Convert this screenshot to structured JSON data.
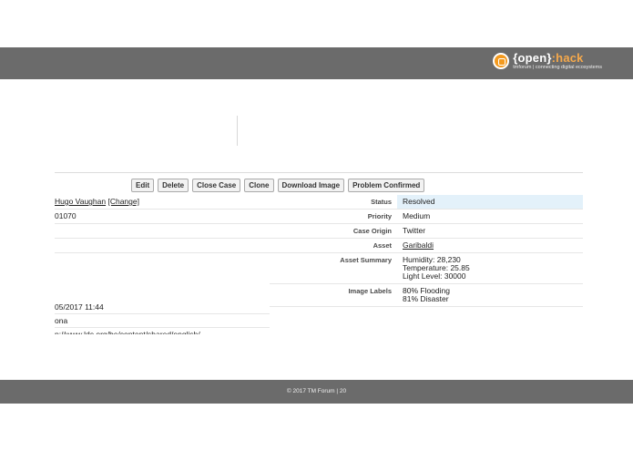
{
  "brand": {
    "name_open": "{open}",
    "name_colon": ":",
    "name_hack": "hack",
    "tagline": "tmforum | connecting digital ecosystems"
  },
  "toolbar": {
    "edit": "Edit",
    "delete": "Delete",
    "close_case": "Close Case",
    "clone": "Clone",
    "download_image": "Download Image",
    "problem_confirmed": "Problem Confirmed"
  },
  "left": {
    "owner": "Hugo Vaughan",
    "change": "[Change]",
    "case_number": "01070",
    "date": "05/2017 11:44",
    "location": "ona",
    "url": "p://www.ldc.org/be/content/shared/english/..."
  },
  "details": [
    {
      "label": "Status",
      "value": [
        "Resolved"
      ]
    },
    {
      "label": "Priority",
      "value": [
        "Medium"
      ]
    },
    {
      "label": "Case Origin",
      "value": [
        "Twitter"
      ]
    },
    {
      "label": "Asset",
      "value": [
        "Garibaldi"
      ]
    },
    {
      "label": "Asset Summary",
      "value": [
        "Humidity: 28,230",
        "Temperature: 25.85",
        "Light Level: 30000"
      ]
    },
    {
      "label": "Image Labels",
      "value": [
        "80% Flooding",
        "81% Disaster"
      ]
    }
  ],
  "footer": {
    "text": "© 2017 TM Forum    |    20"
  },
  "colors": {
    "orange": "#f39a1f",
    "bar": "#6b6b6b",
    "highlight": "#e3f1fa"
  }
}
